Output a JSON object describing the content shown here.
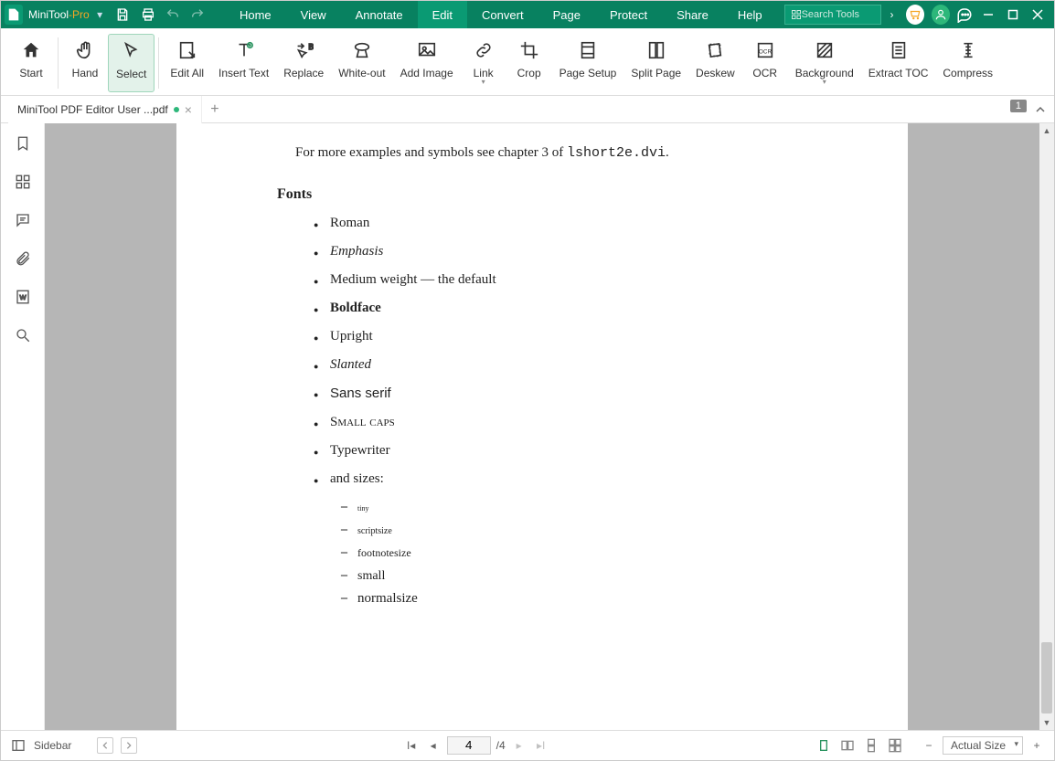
{
  "titlebar": {
    "brand_prefix": "MiniTool",
    "brand_suffix": "-Pro",
    "search_placeholder": "Search Tools"
  },
  "menu": {
    "items": [
      "Home",
      "View",
      "Annotate",
      "Edit",
      "Convert",
      "Page",
      "Protect",
      "Share",
      "Help"
    ],
    "active_index": 3
  },
  "ribbon": {
    "tools": [
      {
        "label": "Start"
      },
      {
        "label": "Hand"
      },
      {
        "label": "Select",
        "selected": true
      },
      {
        "label": "Edit All"
      },
      {
        "label": "Insert Text"
      },
      {
        "label": "Replace"
      },
      {
        "label": "White-out"
      },
      {
        "label": "Add Image"
      },
      {
        "label": "Link",
        "dropdown": true
      },
      {
        "label": "Crop"
      },
      {
        "label": "Page Setup"
      },
      {
        "label": "Split Page"
      },
      {
        "label": "Deskew"
      },
      {
        "label": "OCR"
      },
      {
        "label": "Background",
        "dropdown": true
      },
      {
        "label": "Extract TOC"
      },
      {
        "label": "Compress"
      }
    ]
  },
  "tabs": {
    "open": [
      {
        "title": "MiniTool PDF Editor User ...pdf",
        "modified": true
      }
    ],
    "page_indicator": "1"
  },
  "sidebar_label": "Sidebar",
  "document": {
    "intro_prefix": "For more examples and symbols see chapter 3 of ",
    "intro_code": "lshort2e.dvi",
    "intro_suffix": ".",
    "heading": "Fonts",
    "items": [
      {
        "text": "Roman",
        "style": "normal"
      },
      {
        "text": "Emphasis",
        "style": "italic"
      },
      {
        "text": "Medium weight — the default",
        "style": "normal"
      },
      {
        "text": "Boldface",
        "style": "bold"
      },
      {
        "text": "Upright",
        "style": "normal"
      },
      {
        "text": "Slanted",
        "style": "oblique"
      },
      {
        "text": "Sans serif",
        "style": "sans"
      },
      {
        "text": "Small caps",
        "style": "smallcaps"
      },
      {
        "text": "Typewriter",
        "style": "mono"
      },
      {
        "text": "and sizes:",
        "style": "normal"
      }
    ],
    "sizes": [
      {
        "text": "tiny",
        "size": "8px"
      },
      {
        "text": "scriptsize",
        "size": "10px"
      },
      {
        "text": "footnotesize",
        "size": "12px"
      },
      {
        "text": "small",
        "size": "14px"
      },
      {
        "text": "normalsize",
        "size": "15px"
      }
    ]
  },
  "status": {
    "sidebar_label": "Sidebar",
    "current_page": "4",
    "total_pages": "/4",
    "zoom_label": "Actual Size"
  }
}
